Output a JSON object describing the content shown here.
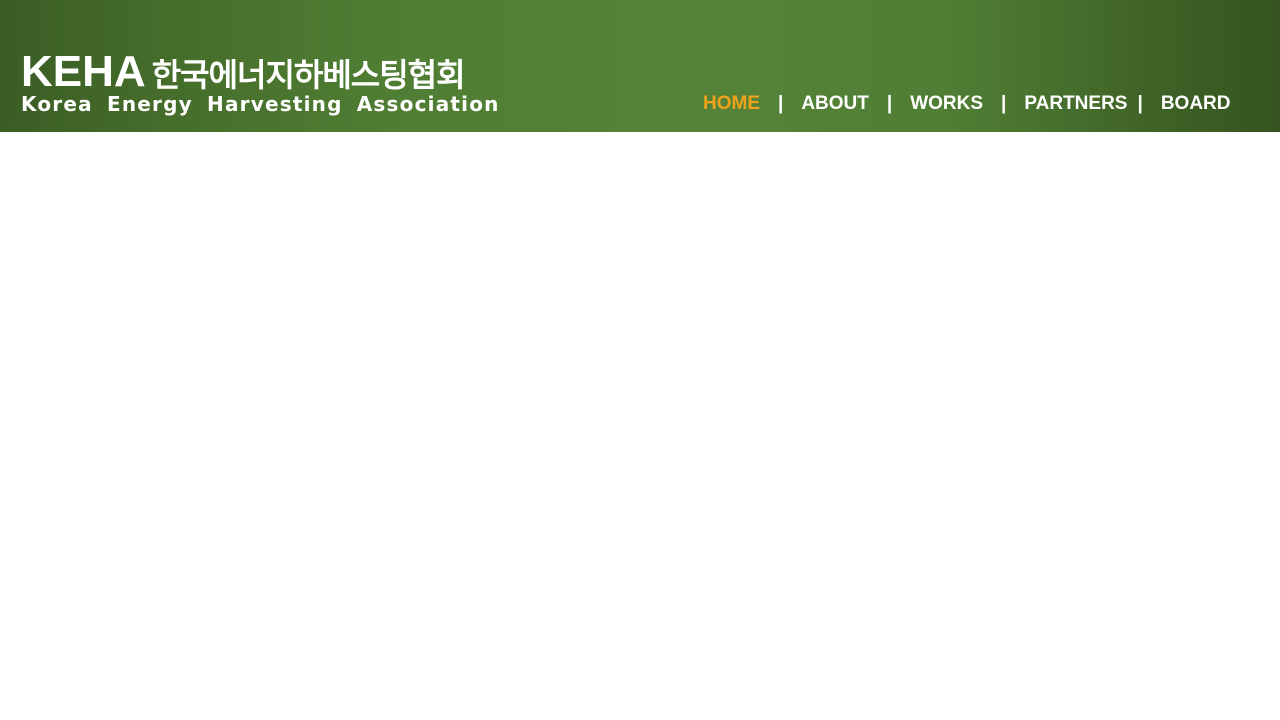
{
  "logo": {
    "abbr": "KEHA",
    "korean": "한국에너지하베스팅협회",
    "english": "Korea Energy Harvesting Association"
  },
  "nav": {
    "items": [
      {
        "label": "HOME",
        "active": true
      },
      {
        "label": "ABOUT",
        "active": false
      },
      {
        "label": "WORKS",
        "active": false
      },
      {
        "label": "PARTNERS",
        "active": false
      },
      {
        "label": "BOARD",
        "active": false
      }
    ],
    "separator": "|"
  },
  "colors": {
    "header_green": "#548338",
    "active_nav": "#f0a21a",
    "text": "#ffffff",
    "page_background": "#ffffff"
  }
}
